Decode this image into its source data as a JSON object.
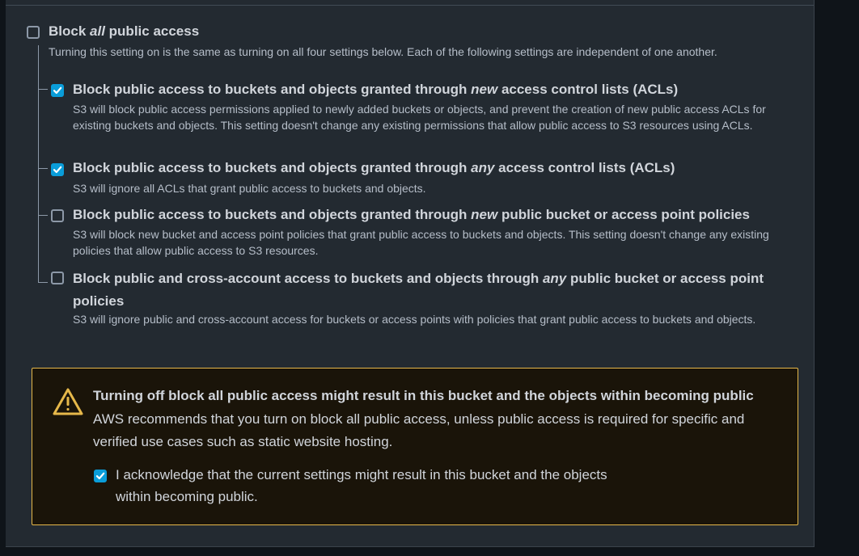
{
  "block_all": {
    "title_pre": "Block ",
    "title_em": "all",
    "title_post": " public access",
    "description": "Turning this setting on is the same as turning on all four settings below. Each of the following settings are independent of one another.",
    "checked": false
  },
  "options": [
    {
      "title_pre": "Block public access to buckets and objects granted through ",
      "title_em": "new",
      "title_post": " access control lists (ACLs)",
      "description": "S3 will block public access permissions applied to newly added buckets or objects, and prevent the creation of new public access ACLs for existing buckets and objects. This setting doesn't change any existing permissions that allow public access to S3 resources using ACLs.",
      "checked": true
    },
    {
      "title_pre": "Block public access to buckets and objects granted through ",
      "title_em": "any",
      "title_post": " access control lists (ACLs)",
      "description": "S3 will ignore all ACLs that grant public access to buckets and objects.",
      "checked": true
    },
    {
      "title_pre": "Block public access to buckets and objects granted through ",
      "title_em": "new",
      "title_post": " public bucket or access point policies",
      "description": "S3 will block new bucket and access point policies that grant public access to buckets and objects. This setting doesn't change any existing policies that allow public access to S3 resources.",
      "checked": false
    },
    {
      "title_pre": "Block public and cross-account access to buckets and objects through ",
      "title_em": "any",
      "title_post": " public bucket or access point policies",
      "description": "S3 will ignore public and cross-account access for buckets or access points with policies that grant public access to buckets and objects.",
      "checked": false
    }
  ],
  "warning": {
    "icon": "warning-triangle-icon",
    "title": "Turning off block all public access might result in this bucket and the objects within becoming public",
    "body": "AWS recommends that you turn on block all public access, unless public access is required for specific and verified use cases such as static website hosting.",
    "acknowledge_label": "I acknowledge that the current settings might result in this bucket and the objects within becoming public.",
    "acknowledge_checked": true
  },
  "colors": {
    "panel_bg": "#232a31",
    "accent_checkbox": "#0a9dd9",
    "warning_border": "#e6b84a",
    "warning_bg": "#1a1409"
  }
}
